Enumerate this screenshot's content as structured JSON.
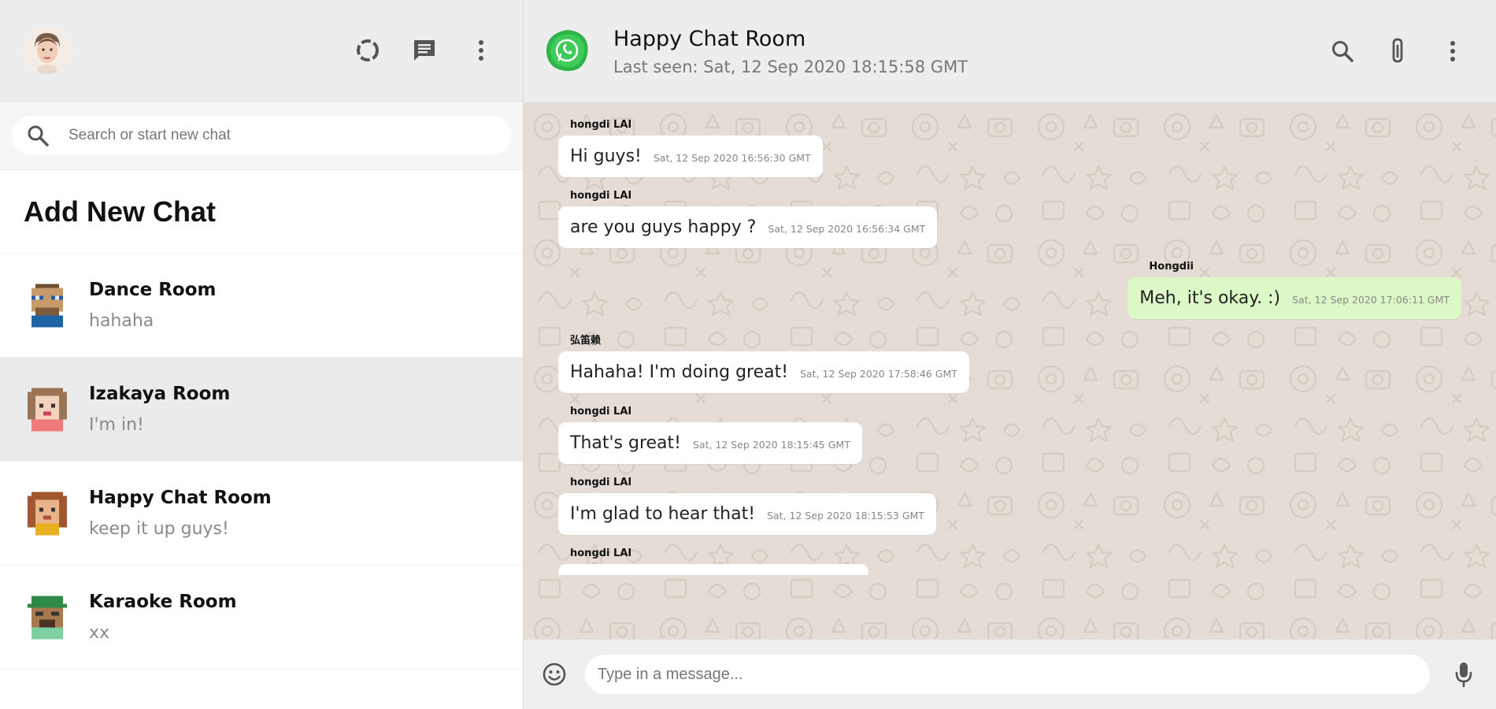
{
  "sidebar": {
    "header": {
      "icons": [
        "status-icon",
        "new-chat-icon",
        "more-vert-icon"
      ]
    },
    "search": {
      "placeholder": "Search or start new chat"
    },
    "add_new_chat": "Add New Chat",
    "chats": [
      {
        "name": "Dance Room",
        "last_message": "hahaha",
        "avatar": "pixel-man-glasses-blue"
      },
      {
        "name": "Izakaya Room",
        "last_message": "I'm in!",
        "avatar": "pixel-woman-brown-hair",
        "active": true
      },
      {
        "name": "Happy Chat Room",
        "last_message": "keep it up guys!",
        "avatar": "pixel-woman-long-hair-yellow"
      },
      {
        "name": "Karaoke Room",
        "last_message": "xx",
        "avatar": "pixel-man-green-cap"
      }
    ]
  },
  "chat": {
    "header": {
      "title": "Happy Chat Room",
      "subtitle": "Last seen: Sat, 12 Sep 2020 18:15:58 GMT",
      "icons": [
        "search-icon",
        "attach-icon",
        "more-vert-icon"
      ]
    },
    "messages": [
      {
        "sender": "hongdi LAI",
        "text": "Hi guys!",
        "time": "Sat, 12 Sep 2020 16:56:30 GMT",
        "mine": false
      },
      {
        "sender": "hongdi LAI",
        "text": "are you guys happy ?",
        "time": "Sat, 12 Sep 2020 16:56:34 GMT",
        "mine": false
      },
      {
        "sender": "Hongdii",
        "text": "Meh, it's okay. :)",
        "time": "Sat, 12 Sep 2020 17:06:11 GMT",
        "mine": true
      },
      {
        "sender": "弘笛赖",
        "text": "Hahaha! I'm doing great!",
        "time": "Sat, 12 Sep 2020 17:58:46 GMT",
        "mine": false
      },
      {
        "sender": "hongdi LAI",
        "text": "That's great!",
        "time": "Sat, 12 Sep 2020 18:15:45 GMT",
        "mine": false
      },
      {
        "sender": "hongdi LAI",
        "text": "I'm glad to hear that!",
        "time": "Sat, 12 Sep 2020 18:15:53 GMT",
        "mine": false
      },
      {
        "sender": "hongdi LAI",
        "text": "",
        "time": "",
        "mine": false,
        "partial": true
      }
    ],
    "footer": {
      "placeholder": "Type in a message...",
      "icons": [
        "emoji-icon",
        "mic-icon"
      ]
    },
    "colors": {
      "background": "#e5ddd5",
      "my_bubble": "#dcf8c6",
      "other_bubble": "#ffffff",
      "header": "#ededed"
    }
  }
}
